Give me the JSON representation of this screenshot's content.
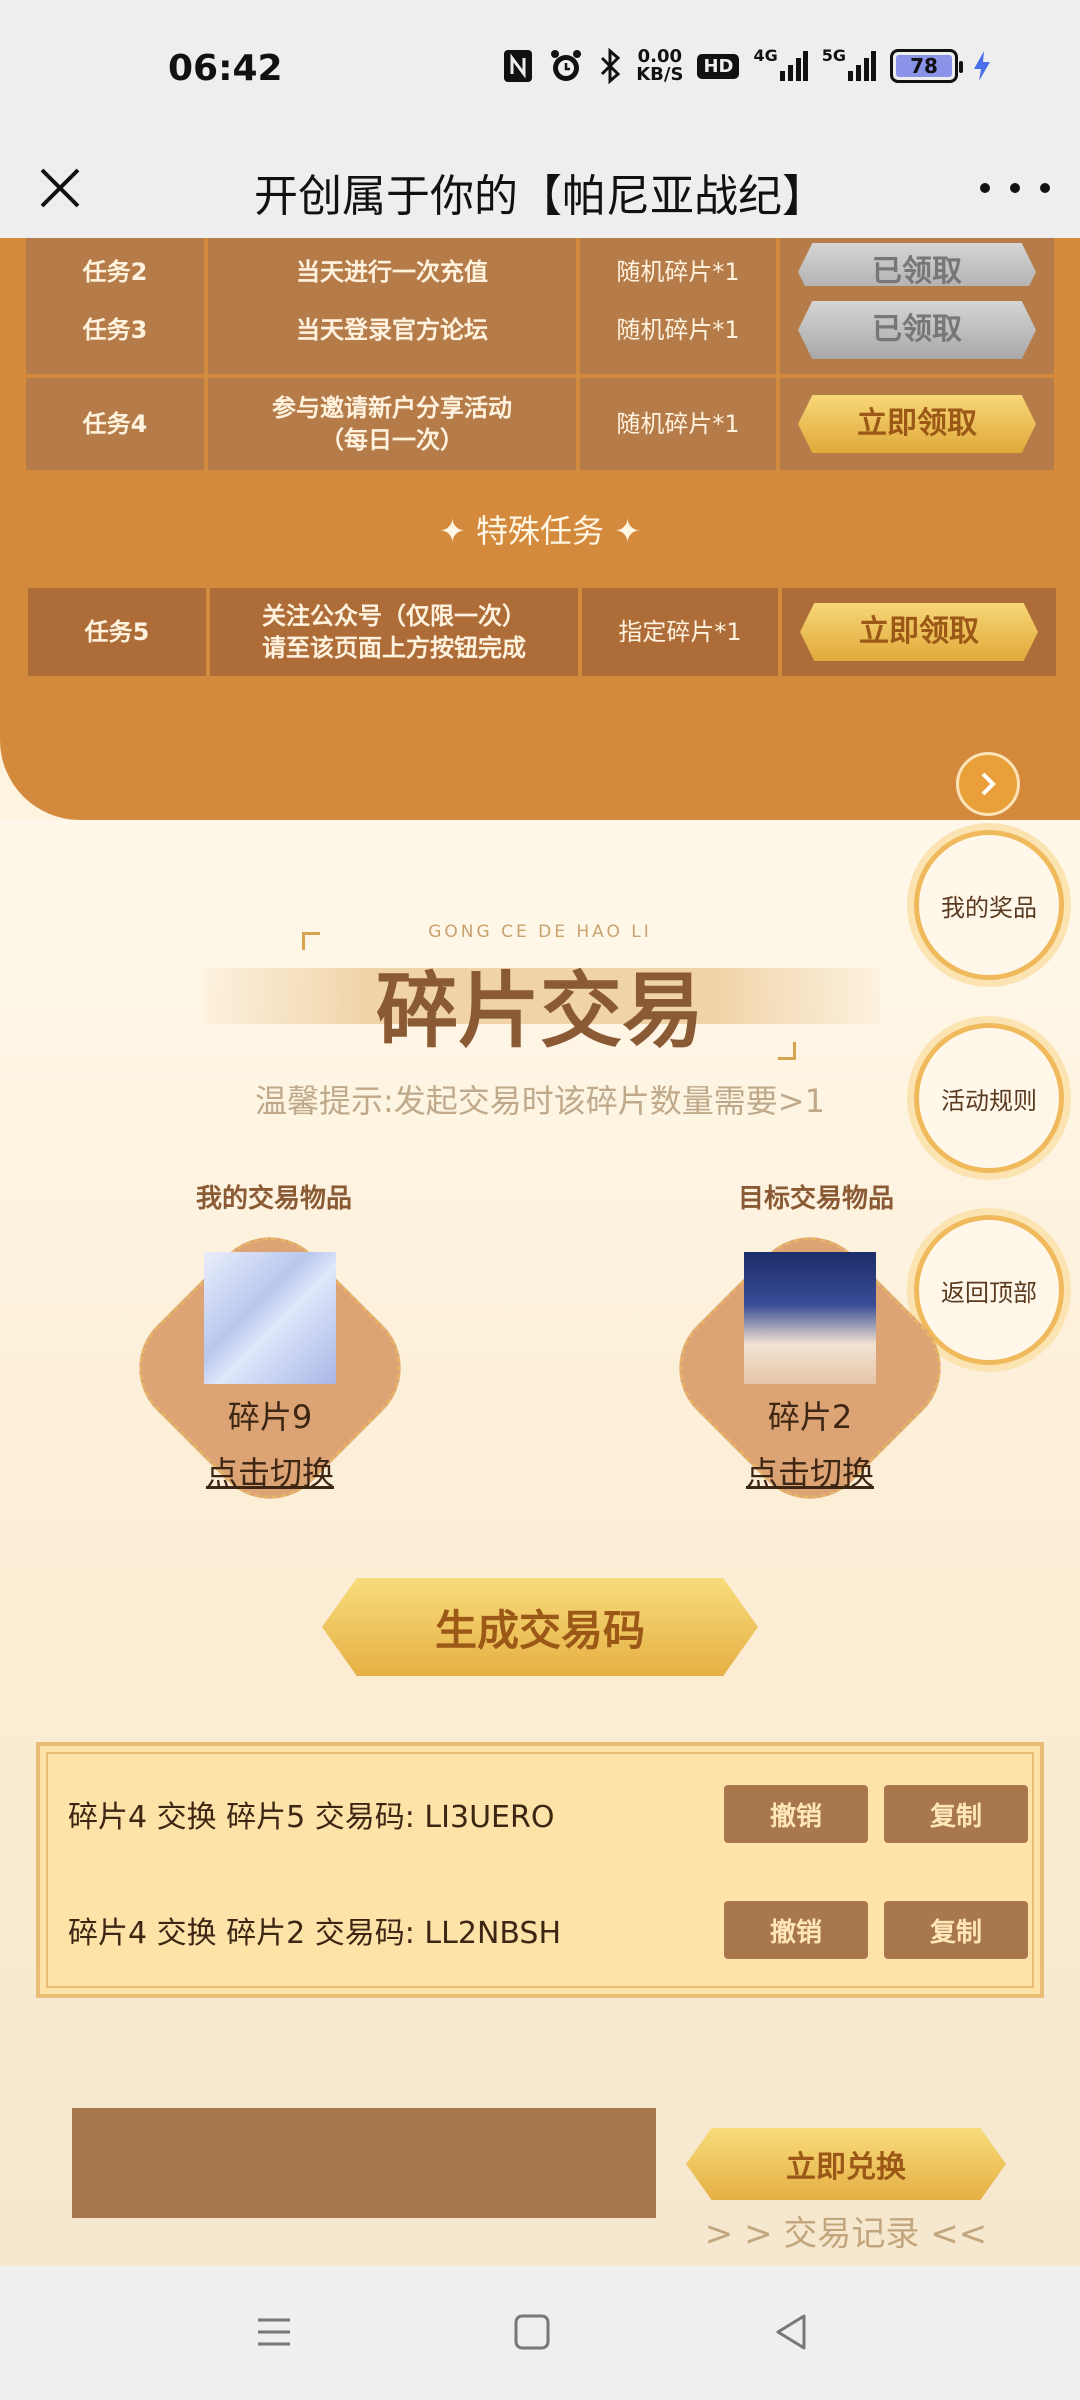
{
  "status_bar": {
    "time": "06:42",
    "net_speed_value": "0.00",
    "net_speed_unit": "KB/S",
    "hd_label": "HD",
    "signal1_label": "4G",
    "signal2_label": "5G",
    "battery": "78",
    "icons": [
      "nfc-icon",
      "alarm-icon",
      "bluetooth-icon",
      "signal-icon",
      "charging-icon"
    ]
  },
  "title_bar": {
    "title": "开创属于你的【帕尼亚战纪】"
  },
  "tasks": {
    "rows": [
      {
        "id": "任务2",
        "desc": "当天进行一次充值",
        "reward": "随机碎片*1",
        "action": "已领取",
        "state": "claimed"
      },
      {
        "id": "任务3",
        "desc": "当天登录官方论坛",
        "reward": "随机碎片*1",
        "action": "已领取",
        "state": "claimed"
      },
      {
        "id": "任务4",
        "desc_line1": "参与邀请新户分享活动",
        "desc_line2": "（每日一次）",
        "reward": "随机碎片*1",
        "action": "立即领取",
        "state": "available"
      }
    ],
    "special_title": "✦ 特殊任务 ✦",
    "special_row": {
      "id": "任务5",
      "desc_line1": "关注公众号（仅限一次）",
      "desc_line2": "请至该页面上方按钮完成",
      "reward": "指定碎片*1",
      "action": "立即领取"
    }
  },
  "side_buttons": {
    "prizes": "我的奖品",
    "rules": "活动规则",
    "top": "返回顶部"
  },
  "trade": {
    "heading_sub": "GONG CE DE HAO LI",
    "heading": "碎片交易",
    "tip": "温馨提示:发起交易时该碎片数量需要>1",
    "my_item_label": "我的交易物品",
    "target_item_label": "目标交易物品",
    "my_item_name": "碎片9",
    "target_item_name": "碎片2",
    "switch_label": "点击切换",
    "generate_button": "生成交易码"
  },
  "codes": [
    {
      "text": "碎片4 交换 碎片5 交易码:  LI3UERO",
      "cancel": "撤销",
      "copy": "复制"
    },
    {
      "text": "碎片4 交换 碎片2 交易码:  LL2NBSH",
      "cancel": "撤销",
      "copy": "复制"
    }
  ],
  "redeem": {
    "button": "立即兑换",
    "record_link": "> > 交易记录 <<"
  },
  "colors": {
    "orange_bg": "#d38a3d",
    "cell_brown": "#b57c4a",
    "gold": "#e5b044",
    "panel": "#fde3a8"
  }
}
